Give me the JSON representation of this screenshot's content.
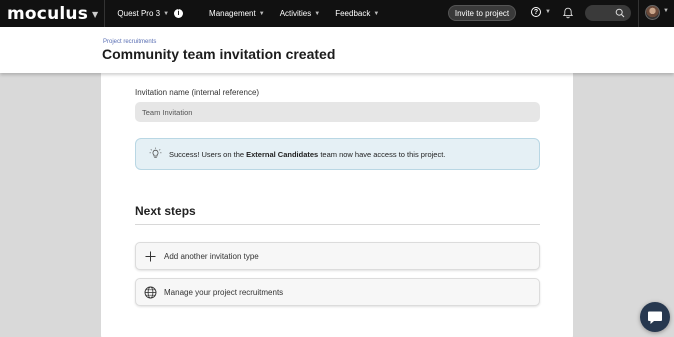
{
  "nav": {
    "logo": "moculus",
    "project": "Quest Pro 3",
    "items": [
      "Management",
      "Activities",
      "Feedback"
    ],
    "invite_button": "Invite to project",
    "help": "?"
  },
  "header": {
    "breadcrumb": "Project recruitments",
    "title": "Community team invitation created"
  },
  "form": {
    "label": "Invitation name (internal reference)",
    "value": "Team Invitation"
  },
  "alert": {
    "prefix": "Success! Users on the ",
    "team": "External Candidates",
    "suffix": " team now have access to this project."
  },
  "next_steps": {
    "title": "Next steps",
    "items": [
      {
        "label": "Add another invitation type",
        "icon": "plus-icon"
      },
      {
        "label": "Manage your project recruitments",
        "icon": "globe-icon"
      }
    ]
  },
  "colors": {
    "nav_bg": "#111111",
    "alert_bg": "#e5f0f5",
    "breadcrumb": "#5a6fb4",
    "chat_fab": "#27384f"
  }
}
